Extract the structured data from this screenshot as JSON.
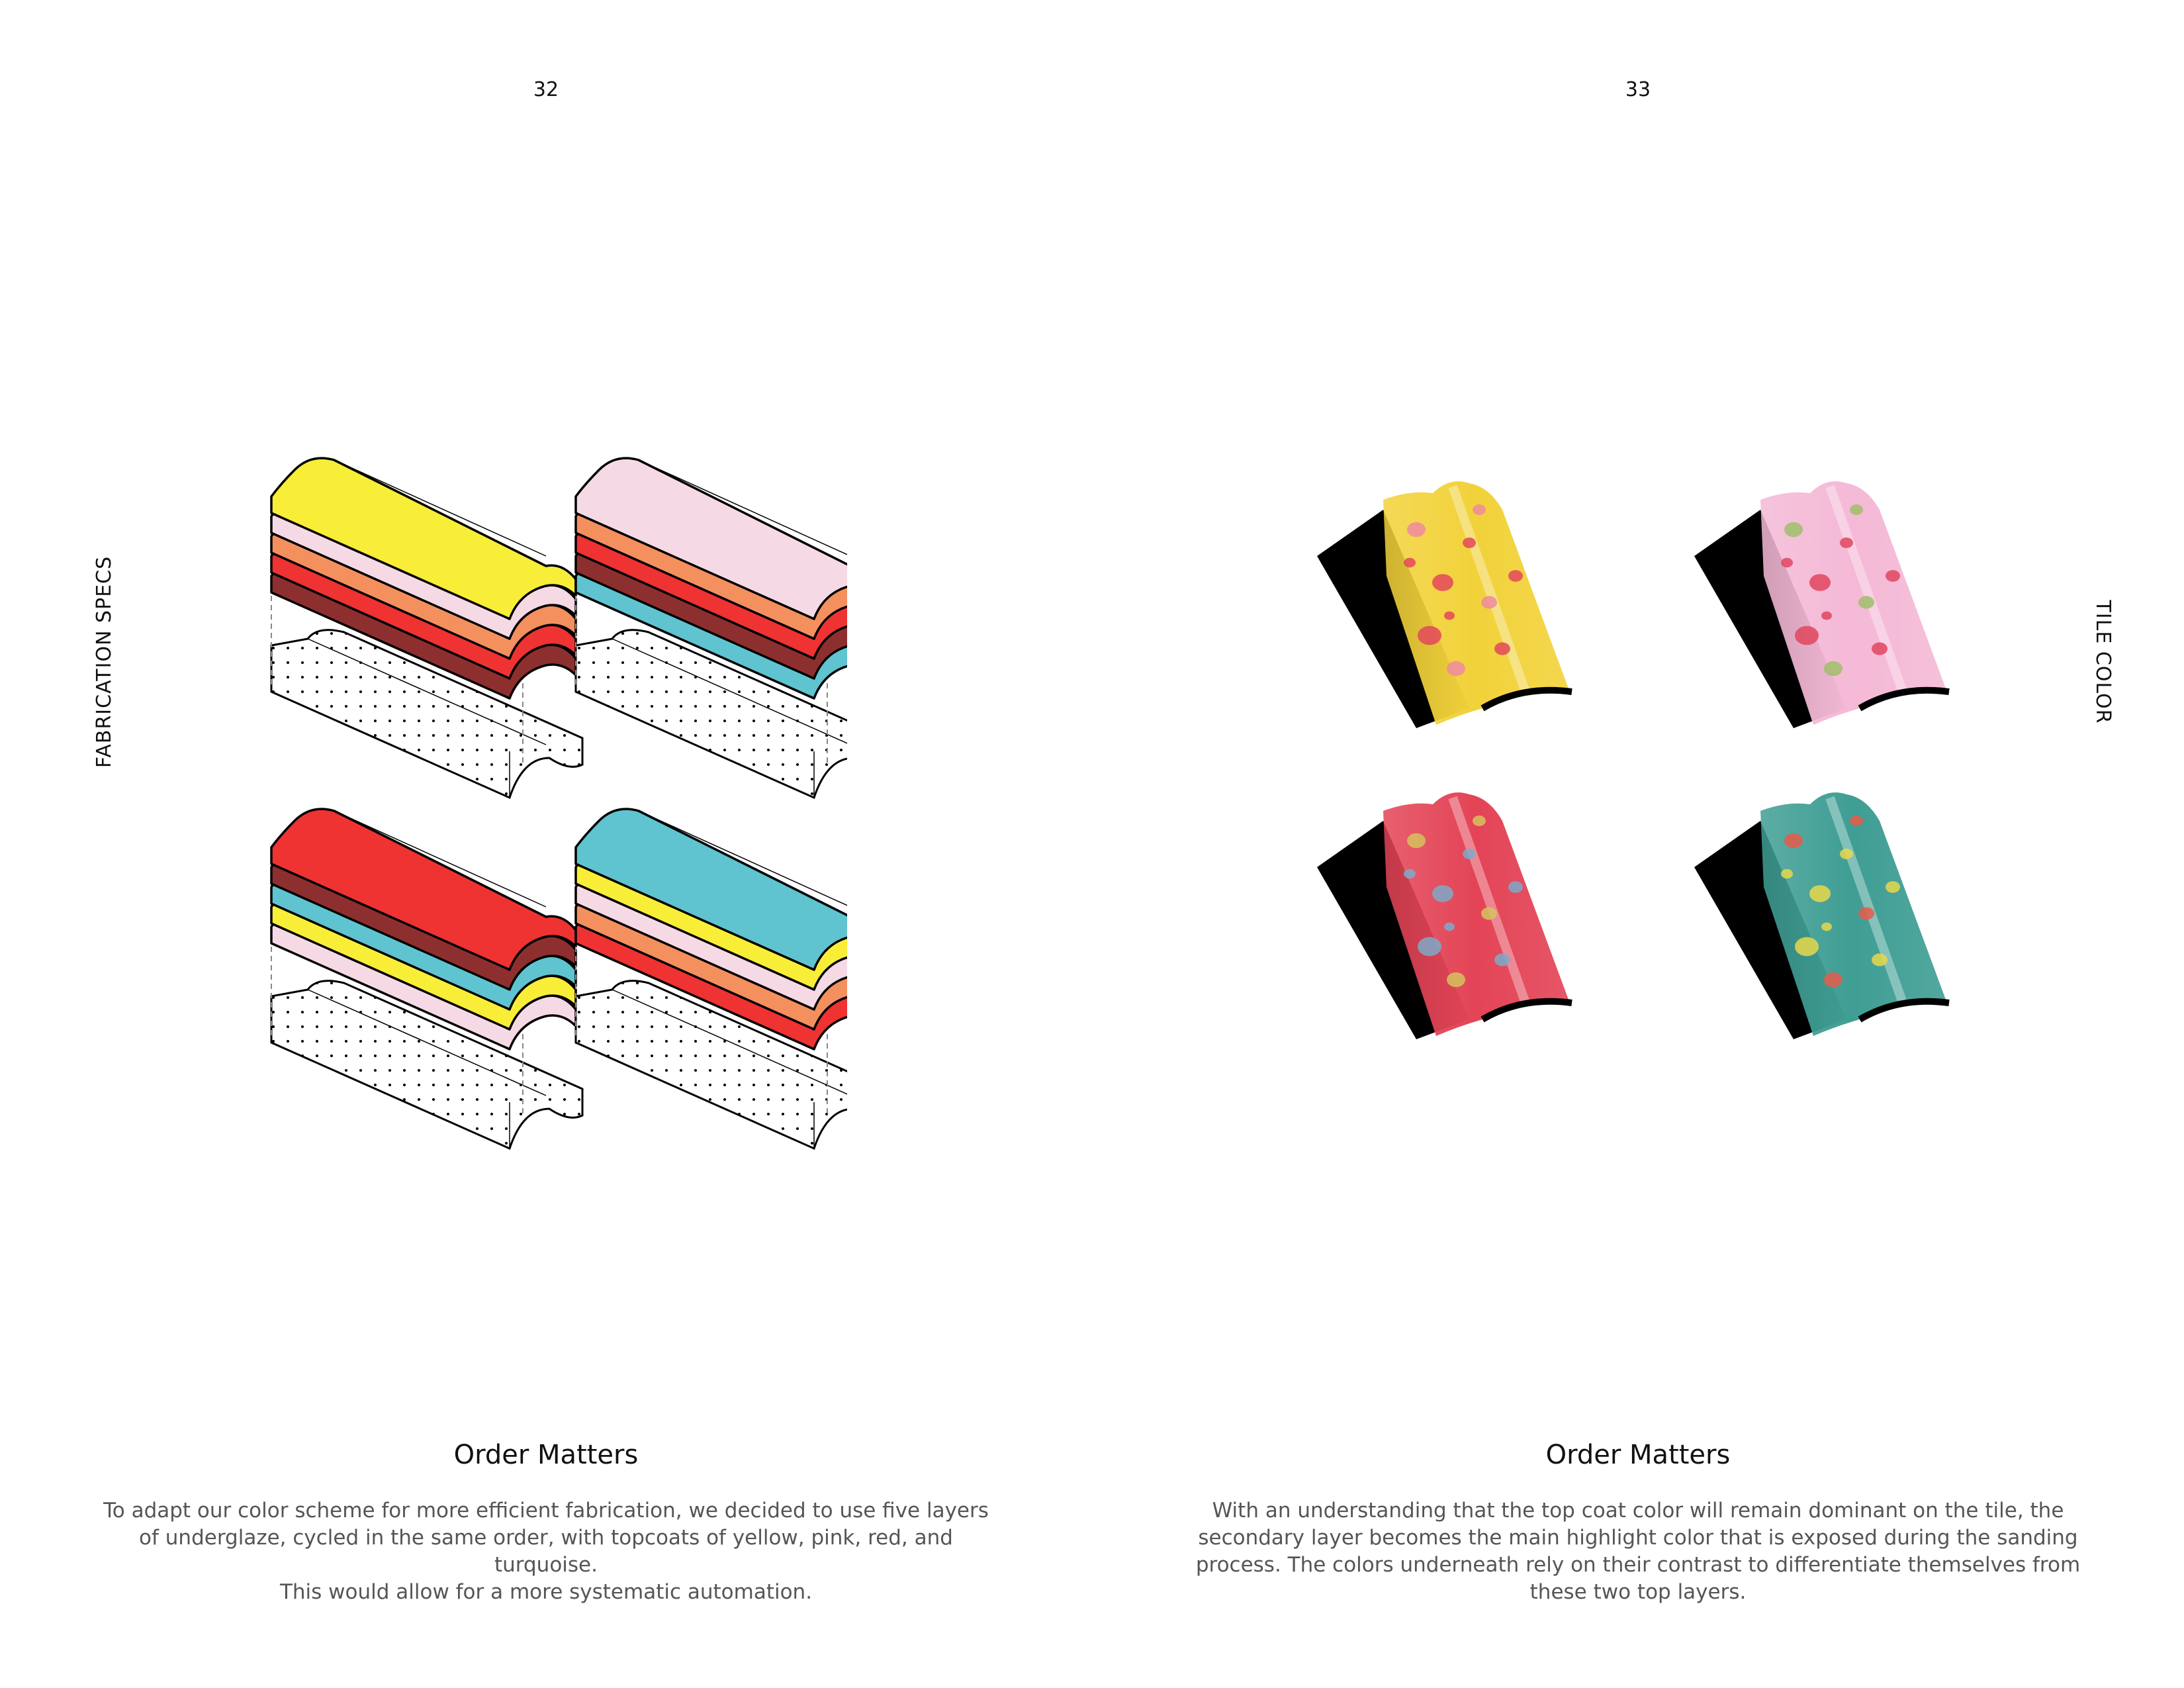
{
  "left": {
    "page_number": "32",
    "side_label": "FABRICATION SPECS",
    "title": "Order Matters",
    "body": [
      "To adapt our color scheme for more efficient fabrication, we decided to use five layers",
      "of underglaze, cycled in the same order, with topcoats of yellow, pink, red, and turquoise.",
      "This would allow for a more systematic automation."
    ]
  },
  "right": {
    "page_number": "33",
    "side_label": "TILE COLOR",
    "title": "Order Matters",
    "body": [
      "With an understanding that the top coat color will remain dominant on the tile, the",
      "secondary layer becomes the main highlight color that is exposed during the sanding",
      "process. The colors underneath rely on their contrast to differentiate themselves from",
      "these two top layers."
    ]
  },
  "colors": {
    "yellow": "#f8ee38",
    "pink": "#f5dae6",
    "orange": "#f4905e",
    "red": "#ef3232",
    "maroon": "#8e2f2f",
    "turquoise": "#5fc4cf"
  },
  "layer_stacks": [
    {
      "name": "yellow-top",
      "layers": [
        "yellow",
        "pink",
        "orange",
        "red",
        "maroon"
      ]
    },
    {
      "name": "pink-top",
      "layers": [
        "pink",
        "orange",
        "red",
        "maroon",
        "turquoise"
      ]
    },
    {
      "name": "red-top",
      "layers": [
        "red",
        "maroon",
        "turquoise",
        "yellow",
        "pink"
      ]
    },
    {
      "name": "turquoise-top",
      "layers": [
        "turquoise",
        "yellow",
        "pink",
        "orange",
        "red"
      ]
    }
  ],
  "tiles": [
    {
      "name": "yellow-tile",
      "base": "#f2d23a",
      "spot": "#e4465a",
      "spot2": "#f08aa0"
    },
    {
      "name": "pink-tile",
      "base": "#f4b9d6",
      "spot": "#e0455e",
      "spot2": "#9fbe6a"
    },
    {
      "name": "red-tile",
      "base": "#e34456",
      "spot": "#7fa9c8",
      "spot2": "#d6c25e"
    },
    {
      "name": "turquoise-tile",
      "base": "#3f9e94",
      "spot": "#e8d84a",
      "spot2": "#e85a4a"
    }
  ]
}
